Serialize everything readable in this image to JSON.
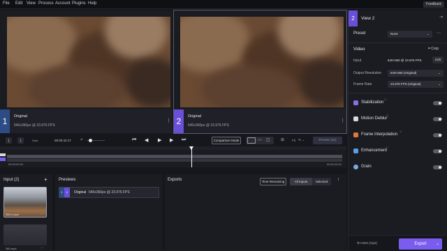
{
  "menu": [
    "File",
    "Edit",
    "View",
    "Process",
    "Account",
    "Plugins",
    "Help"
  ],
  "feedback_label": "Feedback",
  "views": [
    {
      "number": "1",
      "title": "Original",
      "subtitle": "640x360px @ 23.976 FPS"
    },
    {
      "number": "2",
      "title": "Original",
      "subtitle": "640x360px @ 23.976 FPS"
    }
  ],
  "right_panel": {
    "view_number": "2",
    "view_title": "View 2",
    "preset_label": "Preset",
    "preset_value": "None",
    "video_heading": "Video",
    "crop_label": "Crop",
    "input_label": "Input",
    "input_value": "640×360 @ 23.976 FPS",
    "edit_label": "Edit",
    "output_resolution_label": "Output Resolution",
    "output_resolution_value": "640×360 (Original)",
    "frame_rate_label": "Frame Rate",
    "frame_rate_value": "23.976 FPS (Original)",
    "effects": [
      {
        "name": "Stabilization",
        "icon": "stabilization-icon",
        "color": "#8a6fe0",
        "enabled": false
      },
      {
        "name": "Motion Deblur",
        "icon": "motion-deblur-icon",
        "color": "#d9d9de",
        "enabled": false
      },
      {
        "name": "Frame Interpolation",
        "icon": "frame-interpolation-icon",
        "color": "#e07a3a",
        "enabled": false
      },
      {
        "name": "Enhancement",
        "icon": "enhancement-icon",
        "color": "#5aa0e8",
        "enabled": false
      },
      {
        "name": "Grain",
        "icon": "grain-icon",
        "color": "#7fa8d8",
        "enabled": false
      }
    ],
    "export_format": "H264 (mp4)",
    "export_label": "Export"
  },
  "timeline": {
    "start_frame_label": "Start",
    "current_time": "00:00:42:17",
    "comparison_mode_label": "Comparison Mode",
    "zoom_label": "Fit",
    "preview_label": "Preview (5s)",
    "time_start": "00:00:00:00",
    "time_end": "00:01:02:01",
    "playhead_position": 0.55
  },
  "inputs": {
    "title": "Input (2)",
    "items": [
      {
        "name": "360.1.mp4"
      },
      {
        "name": "360.mp4"
      }
    ]
  },
  "previews": {
    "title": "Previews",
    "row": {
      "number": "1",
      "title": "Original",
      "detail": "640x360px @ 23.976 FPS"
    }
  },
  "exports": {
    "title": "Exports",
    "time_remaining_label": "Time Remaining",
    "all_inputs_label": "All Inputs",
    "selected_label": "Selected"
  },
  "colors": {
    "accent": "#7b5cf0",
    "background": "#16171c",
    "panel": "#1b1c22"
  }
}
